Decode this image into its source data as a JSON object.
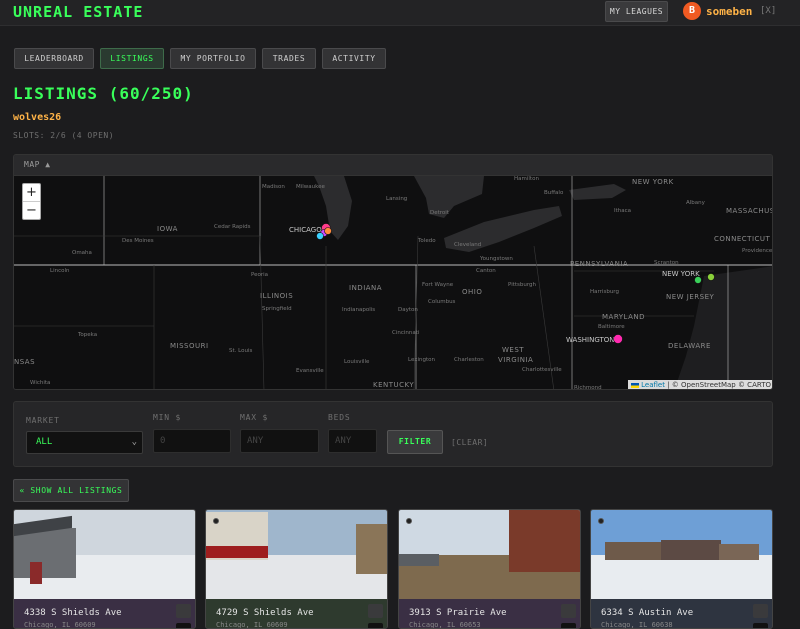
{
  "app": {
    "title": "UNREAL ESTATE"
  },
  "header": {
    "my_leagues": "MY LEAGUES",
    "avatar_initial": "B",
    "username": "someben",
    "logout": "[X]"
  },
  "tabs": [
    {
      "label": "LEADERBOARD",
      "active": false
    },
    {
      "label": "LISTINGS",
      "active": true
    },
    {
      "label": "MY PORTFOLIO",
      "active": false
    },
    {
      "label": "TRADES",
      "active": false
    },
    {
      "label": "ACTIVITY",
      "active": false
    }
  ],
  "listings": {
    "title": "LISTINGS (60/250)",
    "league": "wolves26",
    "slots": "SLOTS: 2/6 (4 OPEN)"
  },
  "map": {
    "toggle": "MAP ▲",
    "zoom_in": "+",
    "zoom_out": "−",
    "attribution_leaflet": "Leaflet",
    "attribution_rest": " | © OpenStreetMap © CARTO",
    "labels": [
      {
        "text": "Madison",
        "cls": "city"
      },
      {
        "text": "Milwaukee",
        "cls": "city"
      },
      {
        "text": "Hamilton",
        "cls": "city"
      },
      {
        "text": "Buffalo",
        "cls": "city"
      },
      {
        "text": "NEW YORK",
        "cls": "state"
      },
      {
        "text": "Ithaca",
        "cls": "city"
      },
      {
        "text": "Albany",
        "cls": "city"
      },
      {
        "text": "MASSACHUS",
        "cls": "state"
      },
      {
        "text": "IOWA",
        "cls": "state"
      },
      {
        "text": "Cedar Rapids",
        "cls": "city"
      },
      {
        "text": "CHICAGO",
        "cls": "city-big"
      },
      {
        "text": "Lansing",
        "cls": "city"
      },
      {
        "text": "Detroit",
        "cls": "city"
      },
      {
        "text": "Des Moines",
        "cls": "city"
      },
      {
        "text": "Toledo",
        "cls": "city"
      },
      {
        "text": "Cleveland",
        "cls": "city"
      },
      {
        "text": "CONNECTICUT",
        "cls": "state"
      },
      {
        "text": "Providence",
        "cls": "city"
      },
      {
        "text": "Omaha",
        "cls": "city"
      },
      {
        "text": "Youngstown",
        "cls": "city"
      },
      {
        "text": "Scranton",
        "cls": "city"
      },
      {
        "text": "Lincoln",
        "cls": "city"
      },
      {
        "text": "Canton",
        "cls": "city"
      },
      {
        "text": "PENNSYLVANIA",
        "cls": "state"
      },
      {
        "text": "Peoria",
        "cls": "city"
      },
      {
        "text": "INDIANA",
        "cls": "state"
      },
      {
        "text": "Fort Wayne",
        "cls": "city"
      },
      {
        "text": "Pittsburgh",
        "cls": "city"
      },
      {
        "text": "NEW YORK",
        "cls": "city-big"
      },
      {
        "text": "ILLINOIS",
        "cls": "state"
      },
      {
        "text": "OHIO",
        "cls": "state"
      },
      {
        "text": "Harrisburg",
        "cls": "city"
      },
      {
        "text": "NEW JERSEY",
        "cls": "state"
      },
      {
        "text": "Springfield",
        "cls": "city"
      },
      {
        "text": "Indianapolis",
        "cls": "city"
      },
      {
        "text": "Dayton",
        "cls": "city"
      },
      {
        "text": "Columbus",
        "cls": "city"
      },
      {
        "text": "Topeka",
        "cls": "city"
      },
      {
        "text": "MARYLAND",
        "cls": "state"
      },
      {
        "text": "Baltimore",
        "cls": "city"
      },
      {
        "text": "Cincinnati",
        "cls": "city"
      },
      {
        "text": "WASHINGTON",
        "cls": "city-big"
      },
      {
        "text": "MISSOURI",
        "cls": "state"
      },
      {
        "text": "St. Louis",
        "cls": "city"
      },
      {
        "text": "DELAWARE",
        "cls": "state"
      },
      {
        "text": "Charleston",
        "cls": "city"
      },
      {
        "text": "WEST",
        "cls": "state"
      },
      {
        "text": "Louisville",
        "cls": "city"
      },
      {
        "text": "Lexington",
        "cls": "city"
      },
      {
        "text": "VIRGINIA",
        "cls": "state"
      },
      {
        "text": "NSAS",
        "cls": "state"
      },
      {
        "text": "Evansville",
        "cls": "city"
      },
      {
        "text": "Charlottesville",
        "cls": "city"
      },
      {
        "text": "Wichita",
        "cls": "city"
      },
      {
        "text": "KENTUCKY",
        "cls": "state"
      },
      {
        "text": "Richmond",
        "cls": "city"
      }
    ],
    "markers": [
      {
        "name": "chicago-marker-1",
        "color": "#ff3c8a"
      },
      {
        "name": "chicago-marker-2",
        "color": "#c84bff"
      },
      {
        "name": "chicago-marker-3",
        "color": "#3ad0ff"
      },
      {
        "name": "chicago-marker-4",
        "color": "#ff8a3c"
      },
      {
        "name": "newyork-marker-1",
        "color": "#3ad05a"
      },
      {
        "name": "newyork-marker-2",
        "color": "#8ad03a"
      },
      {
        "name": "washington-marker-1",
        "color": "#ff2ab0"
      }
    ]
  },
  "filters": {
    "market_label": "MARKET",
    "market_value": "ALL",
    "min_label": "MIN $",
    "min_placeholder": "0",
    "max_label": "MAX $",
    "max_placeholder": "ANY",
    "beds_label": "BEDS",
    "beds_placeholder": "ANY",
    "filter_button": "FILTER",
    "clear": "[CLEAR]"
  },
  "show_all": "« SHOW ALL LISTINGS",
  "cards": [
    {
      "address": "4338 S Shields Ave",
      "city": "Chicago, IL 60609",
      "tint": "#3a2f44",
      "sky": "#cfd6dd",
      "ground": "#e9ecef"
    },
    {
      "address": "4729 S Shields Ave",
      "city": "Chicago, IL 60609",
      "tint": "#2e3a2e",
      "sky": "#9fb6cc",
      "ground": "#e4e6e9"
    },
    {
      "address": "3913 S Prairie Ave",
      "city": "Chicago, IL 60653",
      "tint": "#3a2f44",
      "sky": "#cfd9e3",
      "ground": "#7e6a4e"
    },
    {
      "address": "6334 S Austin Ave",
      "city": "Chicago, IL 60638",
      "tint": "#2e3440",
      "sky": "#6e9fd6",
      "ground": "#e8ecf0"
    }
  ]
}
